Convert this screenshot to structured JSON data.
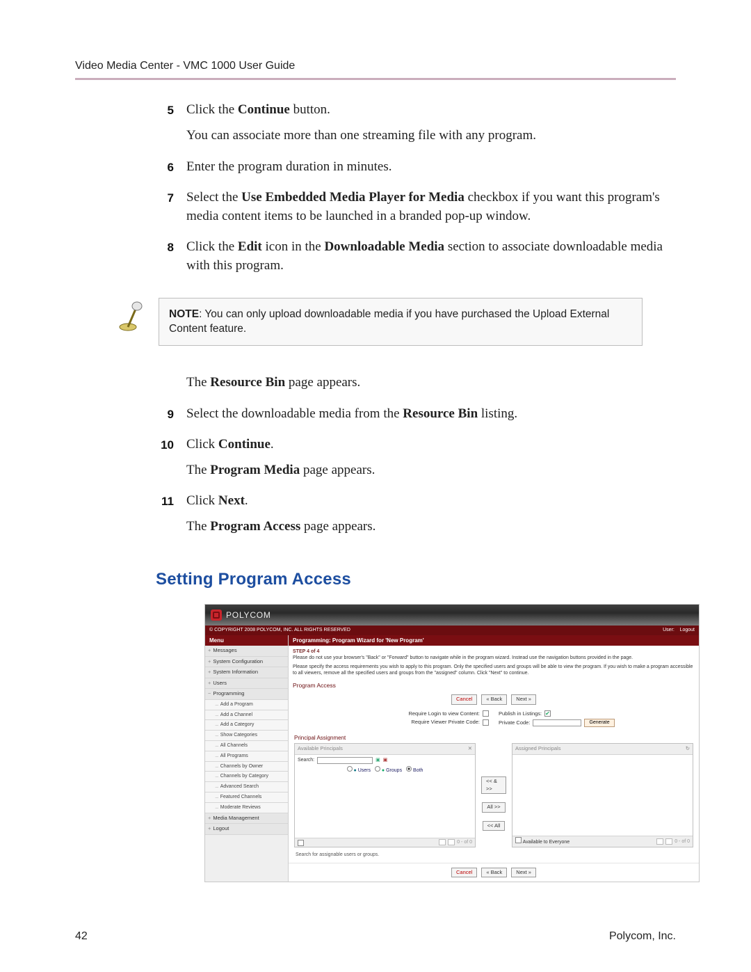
{
  "header": {
    "running_head": "Video Media Center - VMC 1000  User Guide"
  },
  "steps": {
    "s5": {
      "num": "5",
      "line1a": "Click the ",
      "line1b": "Continue",
      "line1c": " button.",
      "line2": "You can associate more than one streaming file with any program."
    },
    "s6": {
      "num": "6",
      "line1": "Enter the program duration in minutes."
    },
    "s7": {
      "num": "7",
      "line1a": "Select the ",
      "line1b": "Use Embedded Media Player for Media",
      "line1c": " checkbox if you want this program's media content items to be launched in a branded pop-up window."
    },
    "s8": {
      "num": "8",
      "line1a": "Click the ",
      "line1b": "Edit",
      "line1c": " icon in the ",
      "line1d": "Downloadable Media",
      "line1e": " section to associate downloadable media with this program."
    },
    "note": {
      "label": "NOTE",
      "text": ": You can only upload downloadable media if you have purchased the Upload External Content feature."
    },
    "after_note": {
      "p1a": "The ",
      "p1b": "Resource Bin",
      "p1c": " page appears."
    },
    "s9": {
      "num": "9",
      "line1a": "Select the downloadable media from the ",
      "line1b": "Resource Bin",
      "line1c": " listing."
    },
    "s10": {
      "num": "10",
      "line1a": "Click ",
      "line1b": "Continue",
      "line1c": ".",
      "p2a": "The ",
      "p2b": "Program Media",
      "p2c": " page appears."
    },
    "s11": {
      "num": "11",
      "line1a": "Click ",
      "line1b": "Next",
      "line1c": ".",
      "p2a": "The ",
      "p2b": "Program Access",
      "p2c": " page appears."
    }
  },
  "section_heading": "Setting Program Access",
  "screenshot": {
    "brand": "POLYCOM",
    "subbar_left": "© COPYRIGHT  2008 POLYCOM, INC.  ALL RIGHTS RESERVED",
    "subbar_user_label": "User:",
    "subbar_logout": "Logout",
    "menu": {
      "title": "Menu",
      "items": [
        "Messages",
        "System Configuration",
        "System Information",
        "Users",
        "Programming"
      ],
      "subs": [
        "Add a Program",
        "Add a Channel",
        "Add a Category",
        "Show Categories",
        "All Channels",
        "All Programs",
        "Channels by Owner",
        "Channels by Category",
        "Advanced Search",
        "Featured Channels",
        "Moderate Reviews"
      ],
      "items_after": [
        "Media Management",
        "Logout"
      ]
    },
    "wizard": {
      "title": "Programming: Program Wizard for 'New Program'",
      "step": "STEP 4 of 4",
      "warn": "Please do not use your browser's \"Back\" or \"Forward\" button to navigate while in the program wizard. Instead use the navigation buttons provided in the page.",
      "desc": "Please specify the access requirements you wish to apply to this program. Only the specified users and groups will be able to view the program. If you wish to make a program accessible to all viewers, remove all the specified users and groups from the \"assigned\" column. Click \"Next\" to continue.",
      "section": "Program Access",
      "btn_cancel": "Cancel",
      "btn_back": "« Back",
      "btn_next": "Next »",
      "f1": "Require Login to view Content:",
      "f2": "Require Viewer Private Code:",
      "f3": "Publish in Listings:",
      "f4": "Private Code:",
      "gen": "Generate",
      "pa_section": "Principal Assignment",
      "pane_left": "Available Principals",
      "pane_right": "Assigned Principals",
      "search_label": "Search:",
      "radio_users": "Users",
      "radio_groups": "Groups",
      "radio_both": "Both",
      "left_foot": "0  -  of 0",
      "right_foot": "0  -  of 0",
      "avail_everyone": "Available to Everyone",
      "mid1": "<< & >>",
      "mid2": "All >>",
      "mid3": "<< All",
      "hint_left": "Search for assignable users or groups."
    }
  },
  "footer": {
    "page_num": "42",
    "company": "Polycom, Inc."
  }
}
